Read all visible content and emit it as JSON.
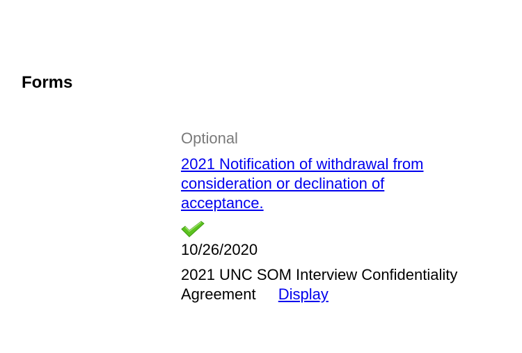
{
  "section": {
    "heading": "Forms"
  },
  "form": {
    "status_label": "Optional",
    "link_text": "2021 Notification of withdrawal from consideration or declination of acceptance.",
    "completed_icon": "checkmark-icon",
    "completed_color": "#5cc21f",
    "date": "10/26/2020"
  },
  "agreement": {
    "title": "2021 UNC SOM Interview Confidentiality Agreement",
    "action_label": "Display"
  },
  "colors": {
    "link": "#0000ee",
    "muted_text": "#7a7a7a"
  }
}
